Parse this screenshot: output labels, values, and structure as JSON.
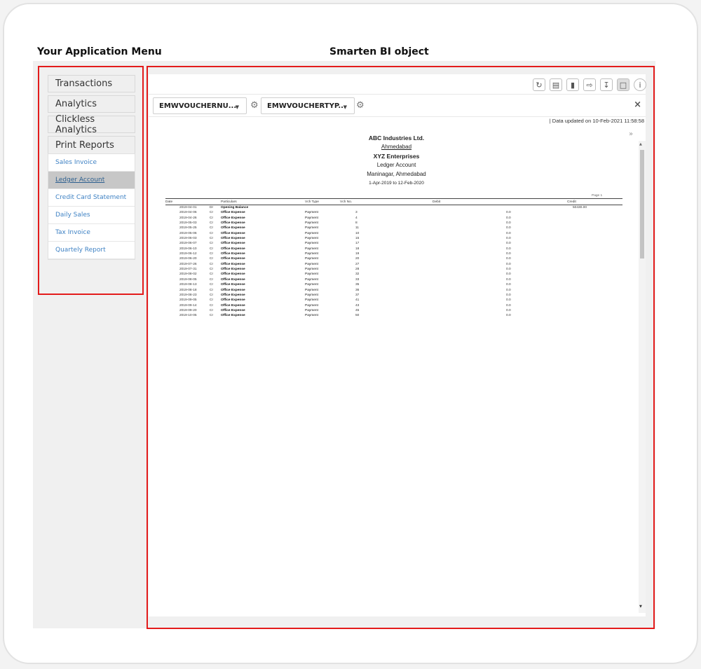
{
  "headings": {
    "app_menu": "Your Application Menu",
    "bi_object": "Smarten BI object"
  },
  "menu": {
    "sections": [
      "Transactions",
      "Analytics",
      "Clickless Analytics",
      "Print Reports"
    ],
    "items": [
      "Sales Invoice",
      "Ledger Account",
      "Credit Card Statement",
      "Daily Sales",
      "Tax Invoice",
      "Quartely Report"
    ],
    "active_item": "Ledger Account"
  },
  "toolbar": {
    "icons": [
      "refresh-icon",
      "save-icon",
      "broadcast-icon",
      "export-icon",
      "download-icon",
      "print-icon",
      "info-icon"
    ]
  },
  "filters": {
    "filter1": "EMWVOUCHERNU...",
    "filter2": "EMWVOUCHERTYP...",
    "close": "×"
  },
  "status": {
    "updated": "|  Data updated on 10-Feb-2021 11:58:58"
  },
  "report": {
    "company": "ABC Industries Ltd.",
    "city": "Ahmedabad",
    "party": "XYZ Enterprises",
    "report_name": "Ledger Account",
    "address": "Maninagar, Ahmedabad",
    "period": "1-Apr-2019 to 12-Feb-2020",
    "page": "Page 1",
    "columns": [
      "Date",
      "Particulars",
      "Vch Type",
      "Vch No.",
      "Debit",
      "Credit"
    ],
    "rows": [
      {
        "date": "2019-04-01",
        "drcr": "Dr",
        "particulars": "Opening Balance",
        "type": "",
        "no": "",
        "debit": "",
        "credit": "50430.00"
      },
      {
        "date": "2019-04-06",
        "drcr": "Cr",
        "particulars": "Office Expense",
        "type": "Payment",
        "no": "3",
        "debit": "0.0",
        "credit": ""
      },
      {
        "date": "2019-04-26",
        "drcr": "Cr",
        "particulars": "Office Expense",
        "type": "Payment",
        "no": "4",
        "debit": "0.0",
        "credit": ""
      },
      {
        "date": "2019-05-03",
        "drcr": "Cr",
        "particulars": "Office Expense",
        "type": "Payment",
        "no": "8",
        "debit": "0.0",
        "credit": ""
      },
      {
        "date": "2019-05-25",
        "drcr": "Cr",
        "particulars": "Office Expense",
        "type": "Payment",
        "no": "11",
        "debit": "0.0",
        "credit": ""
      },
      {
        "date": "2019-05-06",
        "drcr": "Cr",
        "particulars": "Office Expense",
        "type": "Payment",
        "no": "10",
        "debit": "0.0",
        "credit": ""
      },
      {
        "date": "2019-06-03",
        "drcr": "Cr",
        "particulars": "Office Expense",
        "type": "Payment",
        "no": "15",
        "debit": "0.0",
        "credit": ""
      },
      {
        "date": "2019-06-07",
        "drcr": "Cr",
        "particulars": "Office Expense",
        "type": "Payment",
        "no": "17",
        "debit": "0.0",
        "credit": ""
      },
      {
        "date": "2019-06-10",
        "drcr": "Cr",
        "particulars": "Office Expense",
        "type": "Payment",
        "no": "18",
        "debit": "0.0",
        "credit": ""
      },
      {
        "date": "2019-06-12",
        "drcr": "Cr",
        "particulars": "Office Expense",
        "type": "Payment",
        "no": "19",
        "debit": "0.0",
        "credit": ""
      },
      {
        "date": "2019-06-20",
        "drcr": "Cr",
        "particulars": "Office Expense",
        "type": "Payment",
        "no": "20",
        "debit": "0.0",
        "credit": ""
      },
      {
        "date": "2019-07-26",
        "drcr": "Cr",
        "particulars": "Office Expense",
        "type": "Payment",
        "no": "27",
        "debit": "0.0",
        "credit": ""
      },
      {
        "date": "2019-07-31",
        "drcr": "Cr",
        "particulars": "Office Expense",
        "type": "Payment",
        "no": "28",
        "debit": "0.0",
        "credit": ""
      },
      {
        "date": "2019-08-02",
        "drcr": "Cr",
        "particulars": "Office Expense",
        "type": "Payment",
        "no": "32",
        "debit": "0.0",
        "credit": ""
      },
      {
        "date": "2019-08-05",
        "drcr": "Cr",
        "particulars": "Office Expense",
        "type": "Payment",
        "no": "33",
        "debit": "0.0",
        "credit": ""
      },
      {
        "date": "2019-08-13",
        "drcr": "Cr",
        "particulars": "Office Expense",
        "type": "Payment",
        "no": "35",
        "debit": "0.0",
        "credit": ""
      },
      {
        "date": "2019-08-18",
        "drcr": "Cr",
        "particulars": "Office Expense",
        "type": "Payment",
        "no": "36",
        "debit": "0.0",
        "credit": ""
      },
      {
        "date": "2019-08-23",
        "drcr": "Cr",
        "particulars": "Office Expense",
        "type": "Payment",
        "no": "37",
        "debit": "0.0",
        "credit": ""
      },
      {
        "date": "2019-09-05",
        "drcr": "Cr",
        "particulars": "Office Expense",
        "type": "Payment",
        "no": "41",
        "debit": "0.0",
        "credit": ""
      },
      {
        "date": "2019-09-14",
        "drcr": "Cr",
        "particulars": "Office Expense",
        "type": "Payment",
        "no": "43",
        "debit": "0.0",
        "credit": ""
      },
      {
        "date": "2019-09-20",
        "drcr": "Cr",
        "particulars": "Office Expense",
        "type": "Payment",
        "no": "45",
        "debit": "0.0",
        "credit": ""
      },
      {
        "date": "2019-10-05",
        "drcr": "Cr",
        "particulars": "Office Expense",
        "type": "Payment",
        "no": "50",
        "debit": "0.0",
        "credit": ""
      }
    ]
  }
}
